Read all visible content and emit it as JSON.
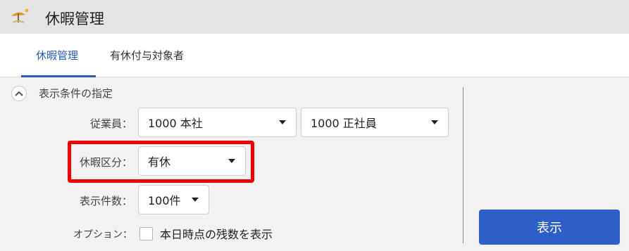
{
  "header": {
    "title": "休暇管理",
    "icon": "beach-umbrella-icon"
  },
  "tabs": [
    {
      "label": "休暇管理",
      "active": true
    },
    {
      "label": "有休付与対象者",
      "active": false
    }
  ],
  "section": {
    "title": "表示条件の指定",
    "collapse_icon": "chevron-up-icon"
  },
  "fields": {
    "employee": {
      "label": "従業員：",
      "value1": "1000 本社",
      "value2": "1000 正社員"
    },
    "leave_type": {
      "label": "休暇区分：",
      "value": "有休"
    },
    "page_size": {
      "label": "表示件数：",
      "value": "100件"
    },
    "options": {
      "label": "オプション：",
      "checkbox_label": "本日時点の残数を表示",
      "checked": false
    }
  },
  "actions": {
    "show_label": "表示"
  },
  "colors": {
    "accent": "#2d5fc7",
    "highlight": "#f00000",
    "tab_active": "#2a5db0"
  }
}
